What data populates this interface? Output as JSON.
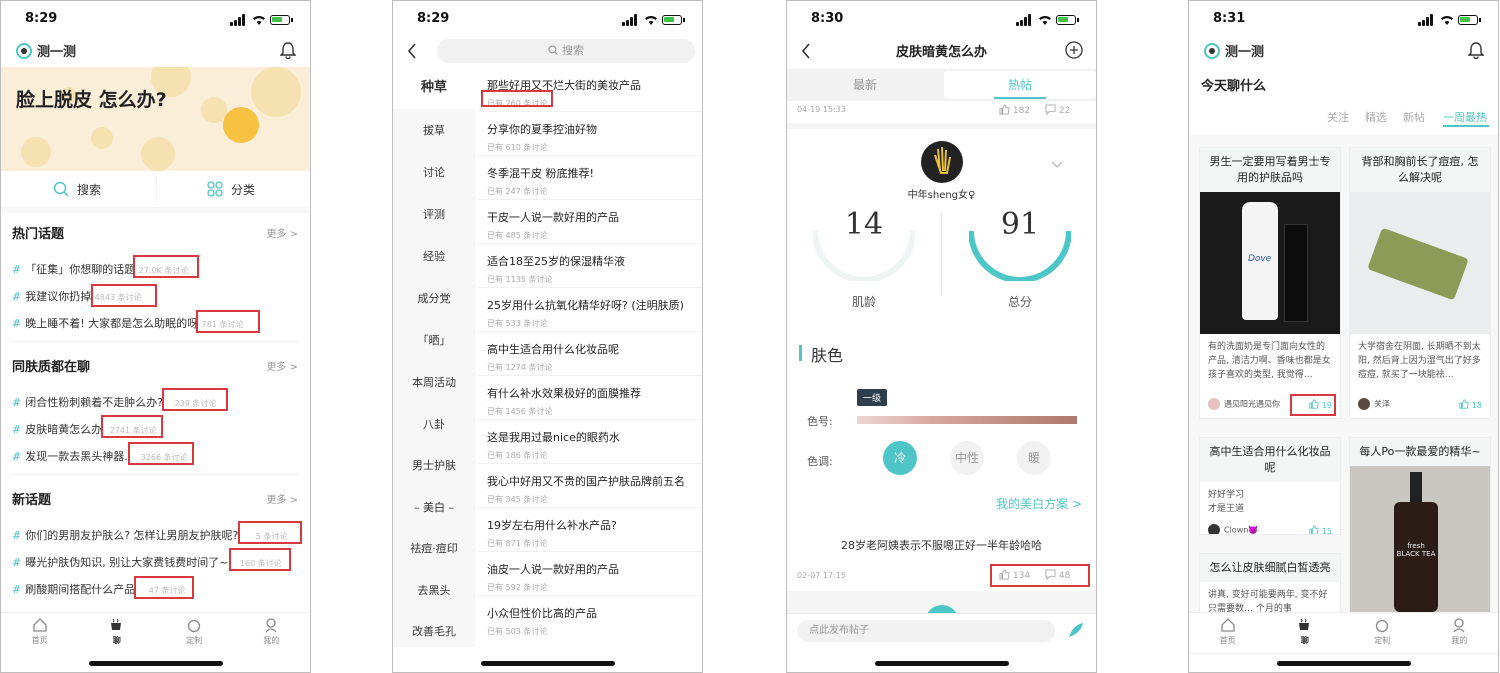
{
  "phones": [
    {
      "time": "8:29",
      "app_title": "测一测",
      "banner_text": "脸上脱皮  怎么办?",
      "quick_actions": [
        "搜索",
        "分类"
      ],
      "sections": [
        {
          "title": "热门话题",
          "more": "更多 >",
          "topics": [
            {
              "title": "「征集」你想聊的话题",
              "count": "27.0K 条讨论"
            },
            {
              "title": "我建议你扔掉",
              "count": "4843 条讨论"
            },
            {
              "title": "晚上睡不着! 大家都是怎么助眠的呀",
              "count": "781 条讨论"
            }
          ]
        },
        {
          "title": "同肤质都在聊",
          "more": "更多 >",
          "topics": [
            {
              "title": "闭合性粉刺赖着不走肿么办?",
              "count": "239 条讨论"
            },
            {
              "title": "皮肤暗黄怎么办",
              "count": "2741 条讨论"
            },
            {
              "title": "发现一款去黑头神器..",
              "count": "3266 条讨论"
            }
          ]
        },
        {
          "title": "新话题",
          "more": "更多 >",
          "topics": [
            {
              "title": "你们的男朋友护肤么? 怎样让男朋友护肤呢?",
              "count": "5 条讨论"
            },
            {
              "title": "曝光护肤伪知识, 别让大家费钱费时间了~",
              "count": "160 条讨论"
            },
            {
              "title": "刷酸期间搭配什么产品",
              "count": "47 条讨论"
            }
          ]
        }
      ],
      "tabs": [
        "首页",
        "聊",
        "定制",
        "我的"
      ],
      "active_tab": "聊"
    },
    {
      "time": "8:29",
      "search_placeholder": "搜索",
      "categories": [
        "种草",
        "拔草",
        "讨论",
        "评测",
        "经验",
        "成分党",
        "「晒」",
        "本周活动",
        "八卦",
        "男士护肤",
        "– 美白 –",
        "祛痘·痘印",
        "去黑头",
        "改善毛孔"
      ],
      "articles": [
        {
          "title": "那些好用又不烂大街的美妆产品",
          "count": "已有 260 条讨论"
        },
        {
          "title": "分享你的夏季控油好物",
          "count": "已有 610 条讨论"
        },
        {
          "title": "冬季混干皮 粉底推荐!",
          "count": "已有 247 条讨论"
        },
        {
          "title": "干皮一人说一款好用的产品",
          "count": "已有 485 条讨论"
        },
        {
          "title": "适合18至25岁的保湿精华液",
          "count": "已有 1135 条讨论"
        },
        {
          "title": "25岁用什么抗氧化精华好呀? (注明肤质)",
          "count": "已有 533 条讨论"
        },
        {
          "title": "高中生适合用什么化妆品呢",
          "count": "已有 1274 条讨论"
        },
        {
          "title": "有什么补水效果极好的面膜推荐",
          "count": "已有 1456 条讨论"
        },
        {
          "title": "这是我用过最nice的眼药水",
          "count": "已有 186 条讨论"
        },
        {
          "title": "我心中好用又不贵的国产护肤品牌前五名",
          "count": "已有 345 条讨论"
        },
        {
          "title": "19岁左右用什么补水产品?",
          "count": "已有 871 条讨论"
        },
        {
          "title": "油皮一人说一款好用的产品",
          "count": "已有 592 条讨论"
        },
        {
          "title": "小众但性价比高的产品",
          "count": "已有 503 条讨论"
        }
      ]
    },
    {
      "time": "8:30",
      "title": "皮肤暗黄怎么办",
      "segments": [
        "最新",
        "热帖"
      ],
      "active_segment": "热帖",
      "top_post": {
        "date": "04-19 15:33",
        "likes": "182",
        "comments": "22"
      },
      "user_name": "中年sheng女♀",
      "skin_age": {
        "value": "14",
        "label": "肌龄"
      },
      "total_score": {
        "value": "91",
        "label": "总分"
      },
      "skin_color_title": "肤色",
      "color_grade_label": "色号:",
      "color_grade_tag": "一级",
      "tone_label": "色调:",
      "tones": [
        "冷",
        "中性",
        "暖"
      ],
      "active_tone": "冷",
      "whitening_link": "我的美白方案 >",
      "post_text": "28岁老阿姨表示不服嗯正好一半年龄哈哈",
      "post_meta": {
        "date": "02-07 17:15",
        "likes": "134",
        "comments": "48"
      },
      "input_placeholder": "点此发布帖子",
      "colors": {
        "accent": "#4ec5c7",
        "swatch_light": "#eed6d2",
        "swatch_dark": "#b0786c"
      }
    },
    {
      "time": "8:31",
      "app_title": "测一测",
      "heading": "今天聊什么",
      "filters": [
        "关注",
        "精选",
        "新帖",
        "一周最热"
      ],
      "active_filter": "一周最热",
      "cards": [
        {
          "title": "男生一定要用写着男士专用的护肤品吗",
          "body": "有的洗面奶是专门面向女性的产品, 清洁力啊、香味也都是女孩子喜欢的类型, 我觉得…",
          "user": "遇见阳光遇见你",
          "likes": "19"
        },
        {
          "title": "背部和胸前长了痘痘, 怎么解决呢",
          "body": "大学宿舍在阴面, 长期晒不到太阳, 然后背上因为湿气出了好多痘痘, 就买了一块能祛…",
          "user": "关泽",
          "likes": "18"
        },
        {
          "title": "高中生适合用什么化妆品呢",
          "body": "好好学习\n才是王道",
          "user": "Clown👿",
          "likes": "15"
        },
        {
          "title": "每人Po一款最爱的精华~",
          "body": "",
          "user": "",
          "likes": ""
        },
        {
          "title": "怎么让皮肤细腻白皙透亮",
          "body": "讲真, 变好可能要两年, 变不好只需要数… 个月的事",
          "user": "",
          "likes": ""
        }
      ],
      "product_labels": [
        "Dove",
        "fresh BLACK TEA"
      ],
      "tabs": [
        "首页",
        "聊",
        "定制",
        "我的"
      ],
      "active_tab": "聊"
    }
  ]
}
